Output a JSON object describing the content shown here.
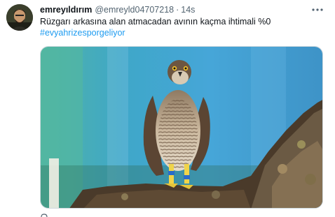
{
  "tweet": {
    "display_name": "emreyıldırım",
    "handle": "@emreyld04707218",
    "separator": "·",
    "time": "14s",
    "text": "Rüzgarı arkasına alan atmacadan avının kaçma ihtimali %0",
    "hashtag": "#evyahrizesporgeliyor"
  },
  "icons": {
    "more": "more-horizontal-icon",
    "reply": "reply-icon"
  },
  "colors": {
    "link": "#1d9bf0",
    "secondary_text": "#536471",
    "primary_text": "#0f1419"
  }
}
